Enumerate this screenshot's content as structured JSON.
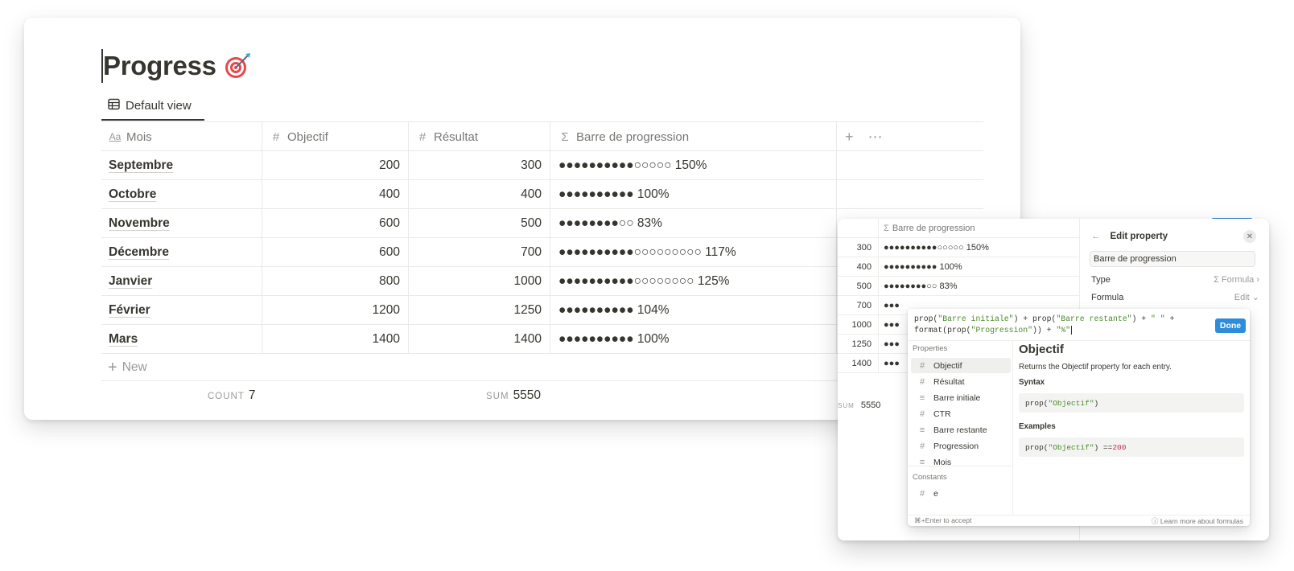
{
  "page": {
    "title": "Progress",
    "icon": "target-dart-icon",
    "view_tab": "Default view"
  },
  "table": {
    "columns": [
      {
        "label": "Mois",
        "icon": "text-aa-icon"
      },
      {
        "label": "Objectif",
        "icon": "number-hash-icon"
      },
      {
        "label": "Résultat",
        "icon": "number-hash-icon"
      },
      {
        "label": "Barre de progression",
        "icon": "sigma-formula-icon"
      }
    ],
    "rows": [
      {
        "mois": "Septembre",
        "objectif": "200",
        "resultat": "300",
        "barre": "●●●●●●●●●●○○○○○ 150%"
      },
      {
        "mois": "Octobre",
        "objectif": "400",
        "resultat": "400",
        "barre": "●●●●●●●●●● 100%"
      },
      {
        "mois": "Novembre",
        "objectif": "600",
        "resultat": "500",
        "barre": "●●●●●●●●○○ 83%"
      },
      {
        "mois": "Décembre",
        "objectif": "600",
        "resultat": "700",
        "barre": "●●●●●●●●●●○○○○○○○○○ 117%"
      },
      {
        "mois": "Janvier",
        "objectif": "800",
        "resultat": "1000",
        "barre": "●●●●●●●●●●○○○○○○○○ 125%"
      },
      {
        "mois": "Février",
        "objectif": "1200",
        "resultat": "1250",
        "barre": "●●●●●●●●●● 104%"
      },
      {
        "mois": "Mars",
        "objectif": "1400",
        "resultat": "1400",
        "barre": "●●●●●●●●●● 100%"
      }
    ],
    "new_label": "New",
    "count_label": "COUNT",
    "count_value": "7",
    "sum_label": "SUM",
    "sum_value": "5550"
  },
  "popup": {
    "mini_header": "Barre de progression",
    "mini_rows": [
      {
        "resultat": "300",
        "barre": "●●●●●●●●●●○○○○○ 150%"
      },
      {
        "resultat": "400",
        "barre": "●●●●●●●●●● 100%"
      },
      {
        "resultat": "500",
        "barre": "●●●●●●●●○○ 83%"
      },
      {
        "resultat": "700",
        "barre": "●●●"
      },
      {
        "resultat": "1000",
        "barre": "●●●"
      },
      {
        "resultat": "1250",
        "barre": "●●●"
      },
      {
        "resultat": "1400",
        "barre": "●●●"
      }
    ],
    "mini_sum_label": "SUM",
    "mini_sum_value": "5550",
    "edit_title": "Edit property",
    "property_name": "Barre de progression",
    "type_label": "Type",
    "type_value": "Formula",
    "formula_label": "Formula",
    "formula_value": "Edit"
  },
  "formula_editor": {
    "line1_a": "prop(",
    "line1_s1": "\"Barre initiale\"",
    "line1_b": ") + prop(",
    "line1_s2": "\"Barre restante\"",
    "line1_c": ") + ",
    "line1_s3": "\" \"",
    "line1_d": " +",
    "line2_a": "format(prop(",
    "line2_s1": "\"Progression\"",
    "line2_b": ")) + ",
    "line2_s2": "\"%\"",
    "done_label": "Done",
    "properties_title": "Properties",
    "properties": [
      {
        "label": "Objectif",
        "icon": "number-hash-icon",
        "selected": true
      },
      {
        "label": "Résultat",
        "icon": "number-hash-icon",
        "selected": false
      },
      {
        "label": "Barre initiale",
        "icon": "text-lines-icon",
        "selected": false
      },
      {
        "label": "CTR",
        "icon": "number-hash-icon",
        "selected": false
      },
      {
        "label": "Barre restante",
        "icon": "text-lines-icon",
        "selected": false
      },
      {
        "label": "Progression",
        "icon": "number-hash-icon",
        "selected": false
      },
      {
        "label": "Mois",
        "icon": "text-lines-icon",
        "selected": false
      }
    ],
    "constants_title": "Constants",
    "constants": [
      {
        "label": "e",
        "icon": "number-hash-icon"
      }
    ],
    "detail_title": "Objectif",
    "detail_desc": "Returns the Objectif property for each entry.",
    "syntax_title": "Syntax",
    "syntax_a": "prop(",
    "syntax_s": "\"Objectif\"",
    "syntax_b": ")",
    "examples_title": "Examples",
    "example_a": "prop(",
    "example_s": "\"Objectif\"",
    "example_b": ") == ",
    "example_n": "200",
    "footer_left": "⌘+Enter to accept",
    "footer_right": "Learn more about formulas"
  }
}
